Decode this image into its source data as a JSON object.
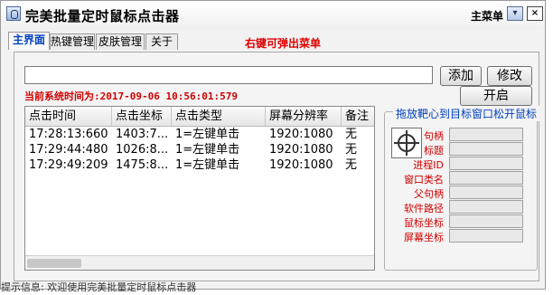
{
  "window": {
    "title": "完美批量定时鼠标点击器",
    "main_menu": "主菜单",
    "minimize_symbol": "▾",
    "close_symbol": "×"
  },
  "tabs": [
    {
      "label": "主界面",
      "active": true
    },
    {
      "label": "热键管理",
      "active": false
    },
    {
      "label": "皮肤管理",
      "active": false
    },
    {
      "label": "关于",
      "active": false
    }
  ],
  "hint": "右键可弹出菜单",
  "command_input": {
    "value": "",
    "placeholder": ""
  },
  "buttons": {
    "add": "添加",
    "edit": "修改",
    "start": "开启"
  },
  "system_time": {
    "label": "当前系统时间为:",
    "value": "2017-09-06  10:56:01:579"
  },
  "table": {
    "columns": [
      "点击时间",
      "点击坐标",
      "点击类型",
      "屏幕分辨率",
      "备注"
    ],
    "rows": [
      [
        "17:28:13:660",
        "1403:7...",
        "1=左键单击",
        "1920:1080",
        "无"
      ],
      [
        "17:29:44:480",
        "1026:8...",
        "1=左键单击",
        "1920:1080",
        "无"
      ],
      [
        "17:29:49:209",
        "1475:8...",
        "1=左键单击",
        "1920:1080",
        "无"
      ]
    ]
  },
  "target_panel": {
    "title": "拖放靶心到目标窗口松开鼠标",
    "fields": [
      {
        "label": "句柄",
        "value": ""
      },
      {
        "label": "标题",
        "value": ""
      },
      {
        "label": "进程ID",
        "value": ""
      },
      {
        "label": "窗口类名",
        "value": ""
      },
      {
        "label": "父句柄",
        "value": ""
      },
      {
        "label": "软件路径",
        "value": ""
      },
      {
        "label": "鼠标坐标",
        "value": ""
      },
      {
        "label": "屏幕坐标",
        "value": ""
      }
    ]
  },
  "status_bar": "提示信息: 欢迎使用完美批量定时鼠标点击器",
  "colors": {
    "accent_red": "#d00000",
    "accent_blue": "#0040c0"
  }
}
